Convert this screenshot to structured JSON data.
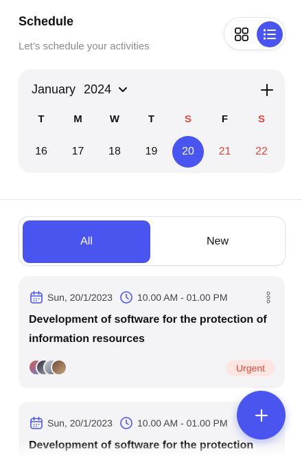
{
  "header": {
    "title": "Schedule",
    "subtitle": "Let’s schedule your activities"
  },
  "view_toggle": {
    "options": [
      "grid",
      "list"
    ],
    "active": "list"
  },
  "calendar": {
    "month": "January",
    "year": "2024",
    "weekdays": [
      {
        "label": "T",
        "weekend": false
      },
      {
        "label": "M",
        "weekend": false
      },
      {
        "label": "W",
        "weekend": false
      },
      {
        "label": "T",
        "weekend": false
      },
      {
        "label": "S",
        "weekend": true
      },
      {
        "label": "F",
        "weekend": false
      },
      {
        "label": "S",
        "weekend": true
      }
    ],
    "days": [
      {
        "label": "16",
        "weekend": false,
        "selected": false
      },
      {
        "label": "17",
        "weekend": false,
        "selected": false
      },
      {
        "label": "18",
        "weekend": false,
        "selected": false
      },
      {
        "label": "19",
        "weekend": false,
        "selected": false
      },
      {
        "label": "20",
        "weekend": true,
        "selected": true
      },
      {
        "label": "21",
        "weekend": false,
        "selected": false
      },
      {
        "label": "22",
        "weekend": true,
        "selected": false
      }
    ]
  },
  "filter_tabs": [
    {
      "label": "All",
      "active": true
    },
    {
      "label": "New",
      "active": false
    }
  ],
  "events": [
    {
      "date": "Sun, 20/1/2023",
      "time": "10.00 AM - 01.00 PM",
      "title": "Development of software for the protection of information resources",
      "badge": "Urgent",
      "participants": [
        "avatar-1",
        "avatar-2",
        "avatar-3",
        "avatar-4"
      ]
    },
    {
      "date": "Sun, 20/1/2023",
      "time": "10.00 AM - 01.00 PM",
      "title": "Development of software for the protection"
    }
  ],
  "colors": {
    "accent": "#4a55ef",
    "weekend": "#e0463c",
    "badge_bg": "#fde6e2",
    "card_bg": "#f4f4f6",
    "muted_text": "#8a8a8a"
  },
  "icons": {
    "view_grid": "grid-icon",
    "view_list": "list-icon",
    "month_dropdown": "chevron-down-icon",
    "add_event": "plus-icon",
    "event_date": "calendar-icon",
    "event_time": "clock-icon",
    "event_menu": "more-vertical-icon",
    "fab": "plus-icon"
  }
}
